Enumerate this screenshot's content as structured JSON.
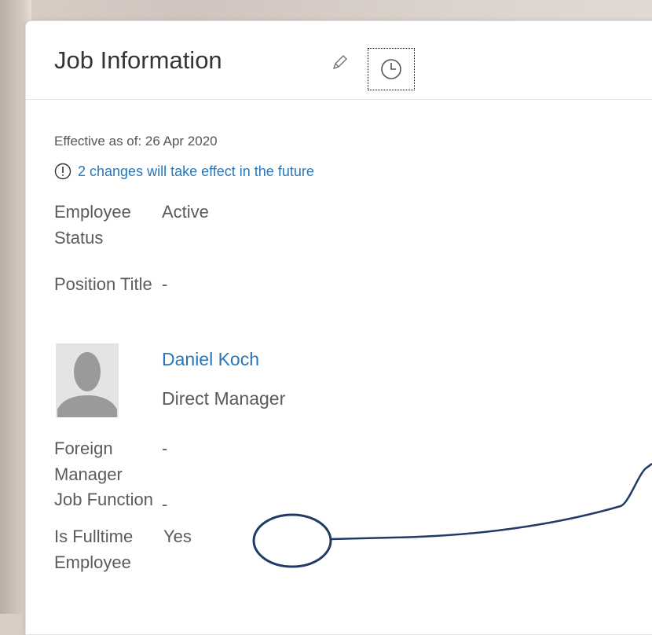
{
  "card": {
    "title": "Job Information",
    "effective_date": "Effective as of: 26 Apr 2020",
    "future_changes": "2 changes will take effect in the future"
  },
  "fields": {
    "employee_status": {
      "label_line1": "Employee",
      "label_line2": "Status",
      "value": "Active"
    },
    "position_title": {
      "label": "Position Title",
      "value": "-"
    },
    "foreign_manager": {
      "label_line1": "Foreign",
      "label_line2": "Manager",
      "value": "-"
    },
    "job_function": {
      "label": "Job Function",
      "value": "-"
    },
    "is_fulltime": {
      "label_line1": "Is Fulltime",
      "label_line2": "Employee",
      "value": "Yes"
    }
  },
  "manager": {
    "name": "Daniel Koch",
    "role": "Direct Manager"
  },
  "icons": {
    "edit": "pencil-icon",
    "history": "clock-icon",
    "info": "exclamation-circle-icon",
    "avatar": "person-silhouette-icon"
  },
  "colors": {
    "link": "#2a76b6",
    "annotation": "#213a66"
  }
}
